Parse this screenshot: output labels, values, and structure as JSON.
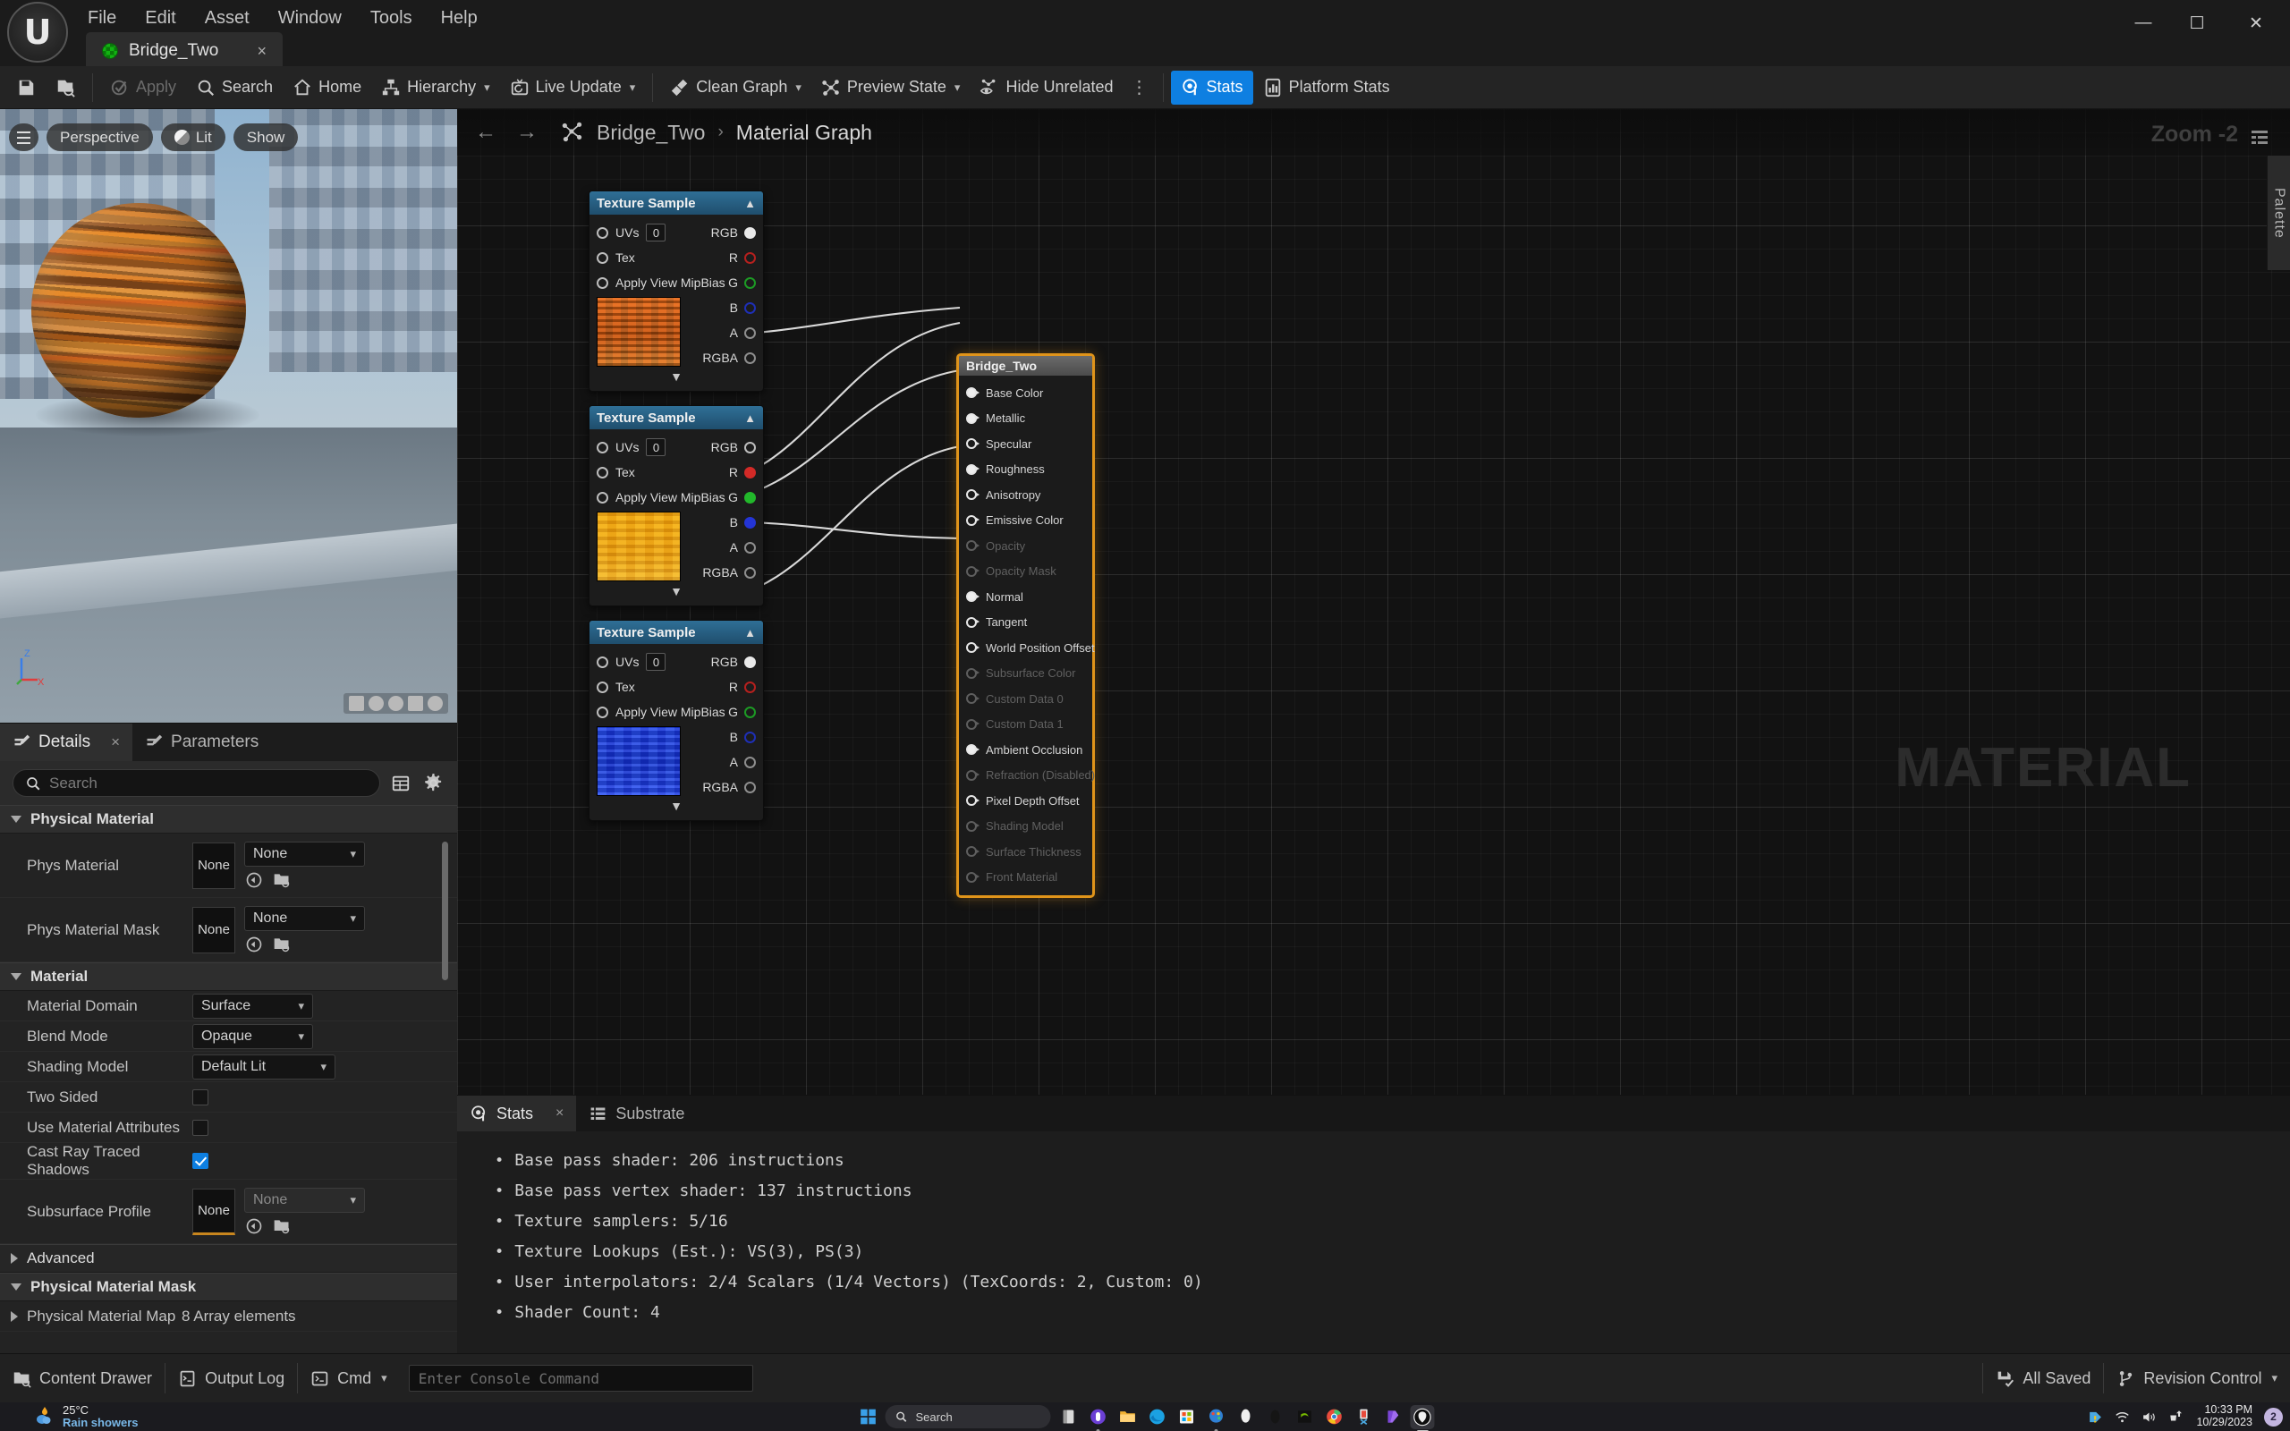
{
  "window": {
    "menu": [
      "File",
      "Edit",
      "Asset",
      "Window",
      "Tools",
      "Help"
    ],
    "asset_tab": {
      "label": "Bridge_Two",
      "close": "×",
      "icon": "checker-green-icon"
    },
    "controls": {
      "minimize": "—",
      "maximize": "☐",
      "close": "✕"
    }
  },
  "toolbar": {
    "save_label": "",
    "items": [
      {
        "label": "Apply",
        "icon": "apply-check-icon",
        "state": "disabled"
      },
      {
        "label": "Search",
        "icon": "magnifier-icon",
        "state": "normal"
      },
      {
        "label": "Home",
        "icon": "home-icon",
        "state": "normal"
      },
      {
        "label": "Hierarchy",
        "icon": "hierarchy-icon",
        "state": "dropdown"
      },
      {
        "label": "Live Update",
        "icon": "live-update-icon",
        "state": "dropdown"
      },
      {
        "label": "Clean Graph",
        "icon": "broom-icon",
        "state": "dropdown"
      },
      {
        "label": "Preview State",
        "icon": "preview-state-icon",
        "state": "dropdown"
      },
      {
        "label": "Hide Unrelated",
        "icon": "eye-node-icon",
        "state": "normal"
      },
      {
        "label": "Stats",
        "icon": "stats-info-icon",
        "state": "active"
      },
      {
        "label": "Platform Stats",
        "icon": "platform-stats-icon",
        "state": "normal"
      }
    ],
    "overflow": "⋮"
  },
  "viewport": {
    "hamburger": "viewport-menu-icon",
    "perspective": "Perspective",
    "lit": "Lit",
    "show": "Show",
    "gizmo": {
      "z": "Z",
      "x": "X"
    }
  },
  "details": {
    "tabs": [
      {
        "label": "Details",
        "icon": "details-pencil-icon",
        "selected": true,
        "closable": true,
        "close": "×"
      },
      {
        "label": "Parameters",
        "icon": "parameters-pencil-icon",
        "selected": false,
        "closable": false
      }
    ],
    "search_placeholder": "Search",
    "buttons": {
      "columns": "columns-icon",
      "settings": "gear-icon"
    },
    "sections": [
      {
        "title": "Physical Material",
        "expanded": true,
        "rows": [
          {
            "name": "Phys Material",
            "type": "asset",
            "asset_text": "None",
            "combo": "None",
            "selected": false
          },
          {
            "name": "Phys Material Mask",
            "type": "asset",
            "asset_text": "None",
            "combo": "None",
            "selected": false
          }
        ]
      },
      {
        "title": "Material",
        "expanded": true,
        "rows": [
          {
            "name": "Material Domain",
            "type": "combo",
            "combo": "Surface"
          },
          {
            "name": "Blend Mode",
            "type": "combo",
            "combo": "Opaque"
          },
          {
            "name": "Shading Model",
            "type": "combo",
            "combo": "Default Lit"
          },
          {
            "name": "Two Sided",
            "type": "check",
            "checked": false
          },
          {
            "name": "Use Material Attributes",
            "type": "check",
            "checked": false
          },
          {
            "name": "Cast Ray Traced Shadows",
            "type": "check",
            "checked": true
          },
          {
            "name": "Subsurface Profile",
            "type": "asset",
            "asset_text": "None",
            "combo": "None",
            "selected": true
          }
        ]
      },
      {
        "title": "Advanced",
        "expanded": false,
        "rows": []
      },
      {
        "title": "Physical Material Mask",
        "expanded": true,
        "rows": [
          {
            "name": "Physical Material Map",
            "type": "text",
            "value": "8 Array elements",
            "collapsible": true
          }
        ]
      }
    ]
  },
  "graph": {
    "nav": {
      "back": "←",
      "forward": "→"
    },
    "breadcrumb_icon": "graph-node-icon",
    "breadcrumb": [
      "Bridge_Two",
      "Material Graph"
    ],
    "breadcrumb_sep": "›",
    "zoom": "Zoom -2",
    "zoom_menu_icon": "graph-options-icon",
    "watermark": "MATERIAL",
    "palette_label": "Palette",
    "texture_nodes": [
      {
        "title": "Texture Sample",
        "inputs": [
          {
            "label": "UVs",
            "has_value_box": true,
            "value": "0"
          },
          {
            "label": "Tex"
          },
          {
            "label": "Apply View MipBias"
          }
        ],
        "outputs": [
          {
            "label": "RGB",
            "color": "white",
            "connected": true
          },
          {
            "label": "R",
            "color": "red",
            "connected": false
          },
          {
            "label": "G",
            "color": "green",
            "connected": false
          },
          {
            "label": "B",
            "color": "blue",
            "connected": false
          },
          {
            "label": "A",
            "color": "gray",
            "connected": false
          },
          {
            "label": "RGBA",
            "color": "gray",
            "connected": false
          }
        ],
        "thumbnail": "orange-basecolor-texture"
      },
      {
        "title": "Texture Sample",
        "inputs": [
          {
            "label": "UVs",
            "has_value_box": true,
            "value": "0"
          },
          {
            "label": "Tex"
          },
          {
            "label": "Apply View MipBias"
          }
        ],
        "outputs": [
          {
            "label": "RGB",
            "color": "white",
            "connected": false
          },
          {
            "label": "R",
            "color": "red",
            "connected": true
          },
          {
            "label": "G",
            "color": "green",
            "connected": true
          },
          {
            "label": "B",
            "color": "blue",
            "connected": true
          },
          {
            "label": "A",
            "color": "gray",
            "connected": false
          },
          {
            "label": "RGBA",
            "color": "gray",
            "connected": false
          }
        ],
        "thumbnail": "yellow-orm-texture"
      },
      {
        "title": "Texture Sample",
        "inputs": [
          {
            "label": "UVs",
            "has_value_box": true,
            "value": "0"
          },
          {
            "label": "Tex"
          },
          {
            "label": "Apply View MipBias"
          }
        ],
        "outputs": [
          {
            "label": "RGB",
            "color": "white",
            "connected": true
          },
          {
            "label": "R",
            "color": "red",
            "connected": false
          },
          {
            "label": "G",
            "color": "green",
            "connected": false
          },
          {
            "label": "B",
            "color": "blue",
            "connected": false
          },
          {
            "label": "A",
            "color": "gray",
            "connected": false
          },
          {
            "label": "RGBA",
            "color": "gray",
            "connected": false
          }
        ],
        "thumbnail": "blue-normal-texture"
      }
    ],
    "material_node": {
      "title": "Bridge_Two",
      "pins": [
        {
          "label": "Base Color",
          "connected": true,
          "enabled": true
        },
        {
          "label": "Metallic",
          "connected": true,
          "enabled": true
        },
        {
          "label": "Specular",
          "connected": false,
          "enabled": true
        },
        {
          "label": "Roughness",
          "connected": true,
          "enabled": true
        },
        {
          "label": "Anisotropy",
          "connected": false,
          "enabled": true
        },
        {
          "label": "Emissive Color",
          "connected": false,
          "enabled": true
        },
        {
          "label": "Opacity",
          "connected": false,
          "enabled": false
        },
        {
          "label": "Opacity Mask",
          "connected": false,
          "enabled": false
        },
        {
          "label": "Normal",
          "connected": true,
          "enabled": true
        },
        {
          "label": "Tangent",
          "connected": false,
          "enabled": true
        },
        {
          "label": "World Position Offset",
          "connected": false,
          "enabled": true
        },
        {
          "label": "Subsurface Color",
          "connected": false,
          "enabled": false
        },
        {
          "label": "Custom Data 0",
          "connected": false,
          "enabled": false
        },
        {
          "label": "Custom Data 1",
          "connected": false,
          "enabled": false
        },
        {
          "label": "Ambient Occlusion",
          "connected": true,
          "enabled": true
        },
        {
          "label": "Refraction (Disabled)",
          "connected": false,
          "enabled": false
        },
        {
          "label": "Pixel Depth Offset",
          "connected": false,
          "enabled": true
        },
        {
          "label": "Shading Model",
          "connected": false,
          "enabled": false
        },
        {
          "label": "Surface Thickness",
          "connected": false,
          "enabled": false
        },
        {
          "label": "Front Material",
          "connected": false,
          "enabled": false
        }
      ]
    }
  },
  "stats": {
    "tabs": [
      {
        "label": "Stats",
        "icon": "stats-info-icon",
        "selected": true,
        "close": "×"
      },
      {
        "label": "Substrate",
        "icon": "substrate-list-icon",
        "selected": false
      }
    ],
    "lines": [
      "Base pass shader: 206 instructions",
      "Base pass vertex shader: 137 instructions",
      "Texture samplers: 5/16",
      "Texture Lookups (Est.): VS(3), PS(3)",
      "User interpolators: 2/4 Scalars (1/4 Vectors) (TexCoords: 2, Custom: 0)",
      "Shader Count: 4"
    ]
  },
  "statusbar": {
    "content_drawer": "Content Drawer",
    "output_log": "Output Log",
    "cmd": "Cmd",
    "console_placeholder": "Enter Console Command",
    "all_saved": "All Saved",
    "revision_control": "Revision Control"
  },
  "taskbar": {
    "weather": {
      "temp": "25°C",
      "desc": "Rain showers",
      "icon": "rain-showers-icon"
    },
    "search_placeholder": "Search",
    "start_icon": "windows-start-icon",
    "apps": [
      "file-explorer-dark-icon",
      "zune-purple-icon",
      "file-explorer-icon",
      "edge-icon",
      "microsoft-store-icon",
      "paint-icon",
      "alienware-icon",
      "dark-app-icon",
      "nvidia-icon",
      "chrome-icon",
      "snipping-tool-icon",
      "purple-app-icon",
      "unreal-engine-icon"
    ],
    "tray": {
      "warning": "warning-icon",
      "wifi": "wifi-icon",
      "volume": "speaker-icon",
      "update": "update-icon"
    },
    "time": "10:33 PM",
    "date": "10/29/2023",
    "badge": "2"
  }
}
